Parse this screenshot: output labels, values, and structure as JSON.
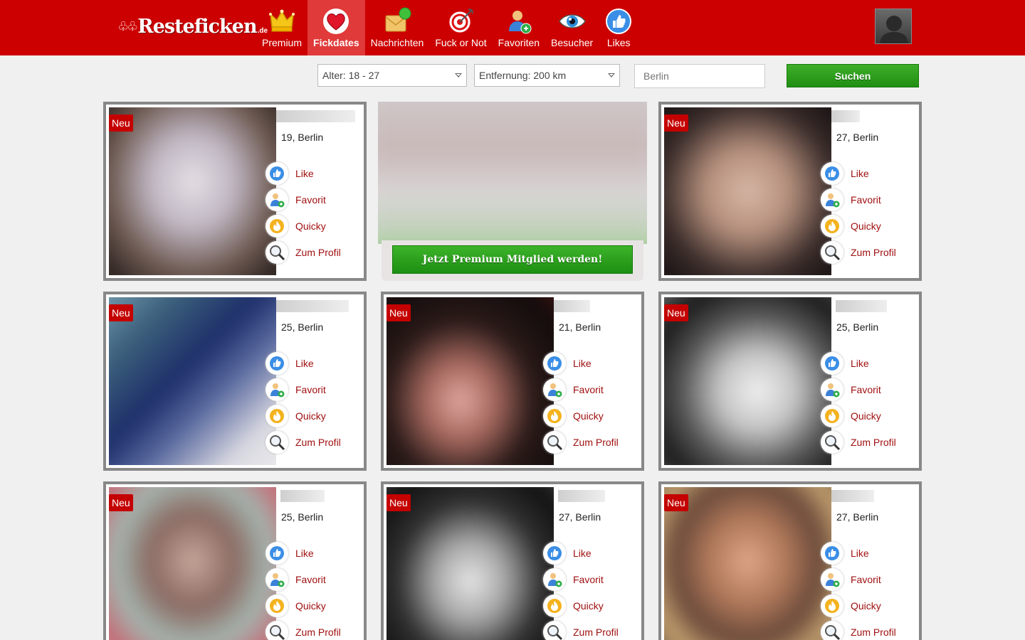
{
  "logo": {
    "mark": "♧♧",
    "word": "Resteficken",
    "tld": ".de"
  },
  "nav": [
    {
      "label": "Premium",
      "icon": "crown-icon"
    },
    {
      "label": "Fickdates",
      "icon": "heart-icon",
      "active": true
    },
    {
      "label": "Nachrichten",
      "icon": "messages-icon"
    },
    {
      "label": "Fuck or Not",
      "icon": "target-icon"
    },
    {
      "label": "Favoriten",
      "icon": "favorites-icon"
    },
    {
      "label": "Besucher",
      "icon": "eye-icon"
    },
    {
      "label": "Likes",
      "icon": "thumbs-up-icon"
    }
  ],
  "filters": {
    "age": "Alter: 18 - 27",
    "distance": "Entfernung: 200 km",
    "city_placeholder": "Berlin",
    "search_label": "Suchen"
  },
  "premium_cta": "Jetzt Premium Mitglied werden!",
  "badge_new": "Neu",
  "actions": {
    "like": "Like",
    "favorit": "Favorit",
    "quicky": "Quicky",
    "profil": "Zum Profil"
  },
  "profiles": [
    {
      "agecity": "19, Berlin"
    },
    {
      "agecity": "27, Berlin"
    },
    {
      "agecity": "25, Berlin"
    },
    {
      "agecity": "21, Berlin"
    },
    {
      "agecity": "25, Berlin"
    },
    {
      "agecity": "25, Berlin"
    },
    {
      "agecity": "27, Berlin"
    },
    {
      "agecity": "27, Berlin"
    }
  ],
  "colors": {
    "brand_red": "#cc0000",
    "accent_green": "#2aa11c",
    "action_text": "#a01010"
  }
}
